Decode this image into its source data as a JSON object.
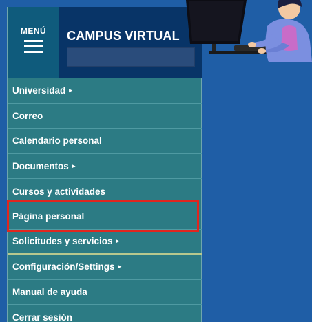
{
  "header": {
    "menu_label": "MENÚ",
    "title": "CAMPUS VIRTUAL"
  },
  "menu": {
    "items": [
      {
        "label": "Universidad",
        "arrow": "▸"
      },
      {
        "label": "Correo",
        "arrow": ""
      },
      {
        "label": "Calendario personal",
        "arrow": ""
      },
      {
        "label": "Documentos",
        "arrow": "▸"
      },
      {
        "label": "Cursos y actividades",
        "arrow": ""
      },
      {
        "label": "Página personal",
        "arrow": ""
      },
      {
        "label": "Solicitudes y servicios",
        "arrow": "▸"
      },
      {
        "label": "Configuración/Settings",
        "arrow": "▸"
      },
      {
        "label": "Manual de ayuda",
        "arrow": ""
      },
      {
        "label": "Cerrar sesión",
        "arrow": ""
      }
    ]
  },
  "colors": {
    "background": "#1f5ea6",
    "menu_bg": "#2c7b84",
    "menu_button_bg": "#0f5b7c",
    "brand_bg": "#083467",
    "highlight": "#e0261f"
  },
  "icons": {
    "menu": "hamburger-icon",
    "submenu": "caret-right-icon",
    "illustration": "person-at-computer-illustration"
  }
}
